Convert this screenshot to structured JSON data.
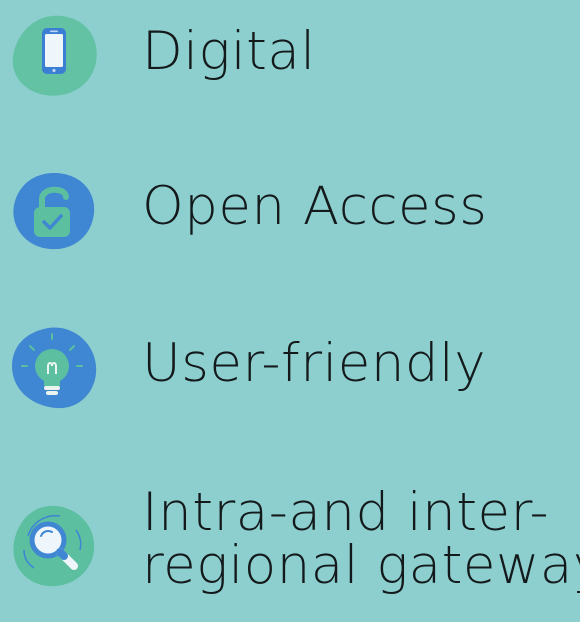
{
  "features": [
    {
      "label": "Digital",
      "icon": "smartphone-icon"
    },
    {
      "label": "Open Access",
      "icon": "open-padlock-icon"
    },
    {
      "label": "User-friendly",
      "icon": "lightbulb-icon"
    },
    {
      "label_line1": "Intra-and inter-",
      "label_line2": "regional gateway",
      "icon": "magnifier-icon"
    }
  ],
  "colors": {
    "background": "#8dcfcf",
    "text": "#141a1b",
    "green_blob": "#5cbf9f",
    "blue_blob": "#3f86d3"
  }
}
